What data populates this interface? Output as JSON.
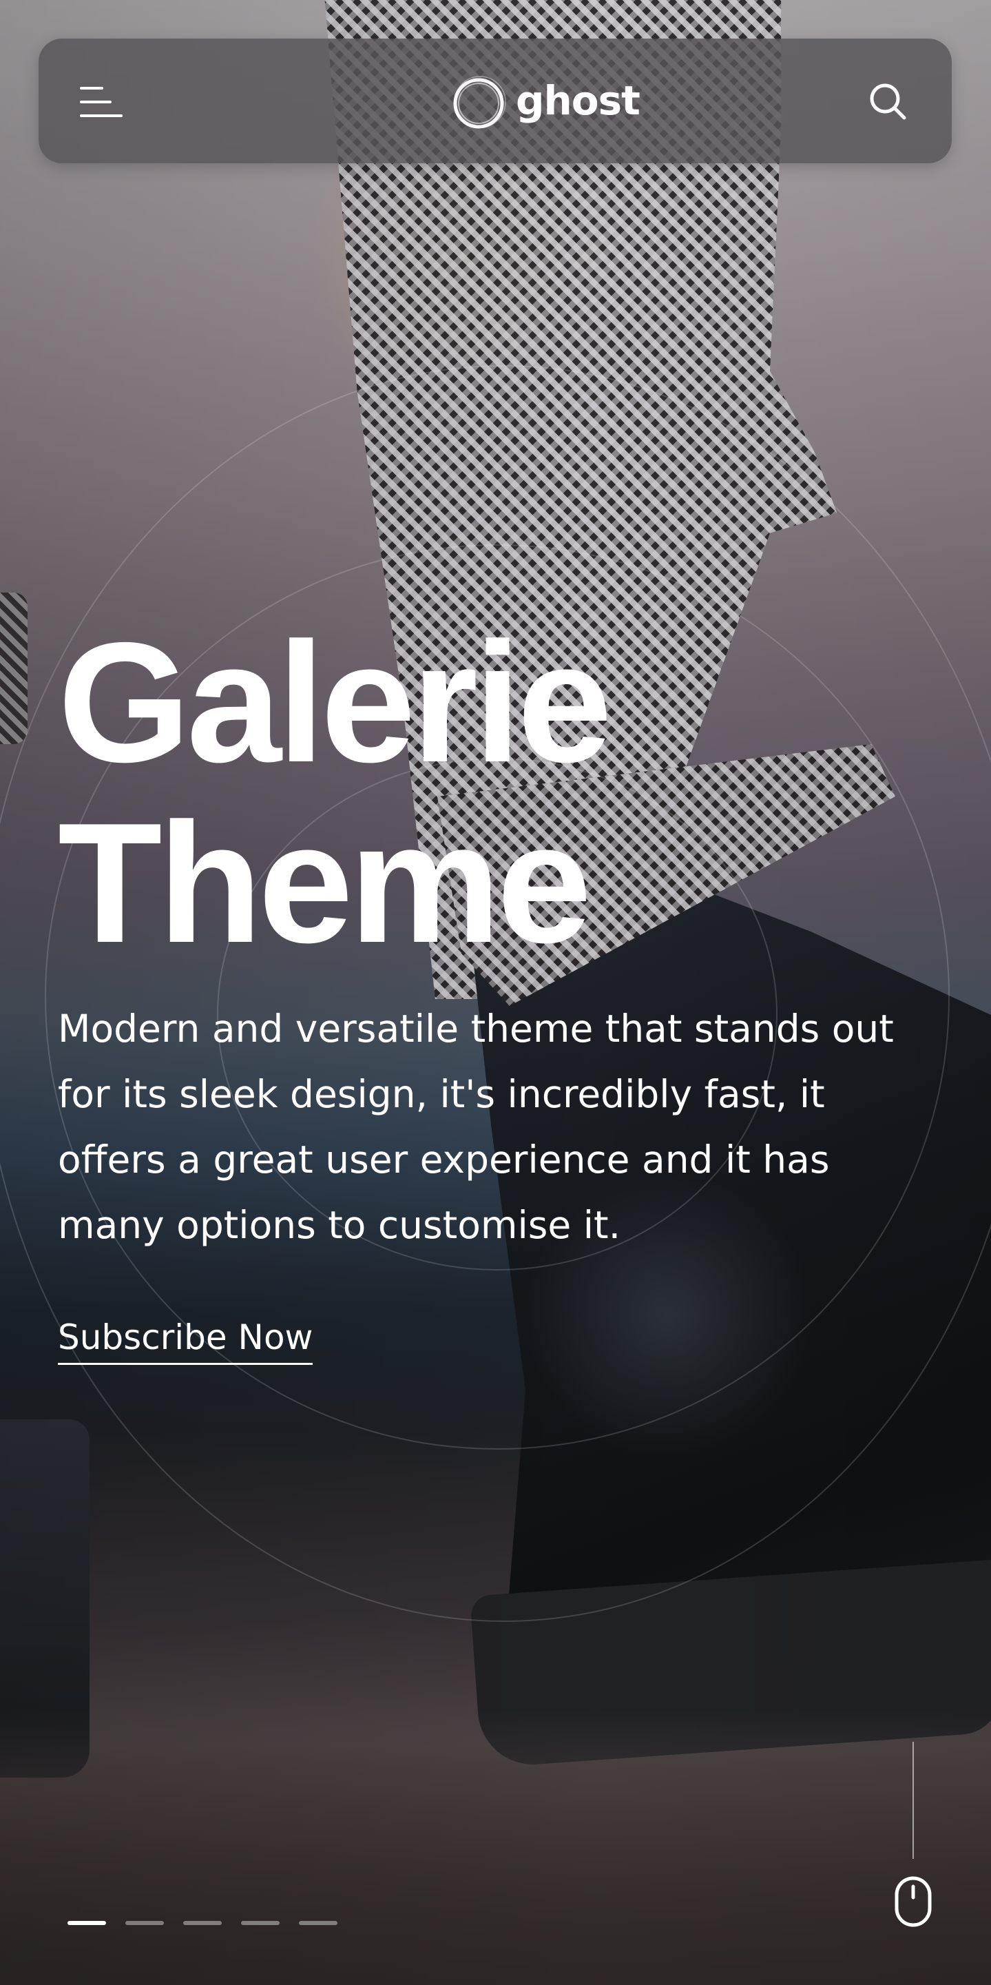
{
  "header": {
    "brand": "ghost",
    "menu_icon": "hamburger-menu-icon",
    "search_icon": "search-icon"
  },
  "hero": {
    "title_line1": "Galerie",
    "title_line2": "Theme",
    "description": "Modern and versatile theme that stands out for its sleek design, it's incredibly fast, it offers a great user experience and it has many options to customise it.",
    "cta_label": "Subscribe Now"
  },
  "slider": {
    "slide_count": 5,
    "active_index": 0
  },
  "scroll_indicator": {
    "icon": "mouse-scroll-icon"
  },
  "colors": {
    "text": "#ffffff",
    "header_bg": "#585458"
  }
}
